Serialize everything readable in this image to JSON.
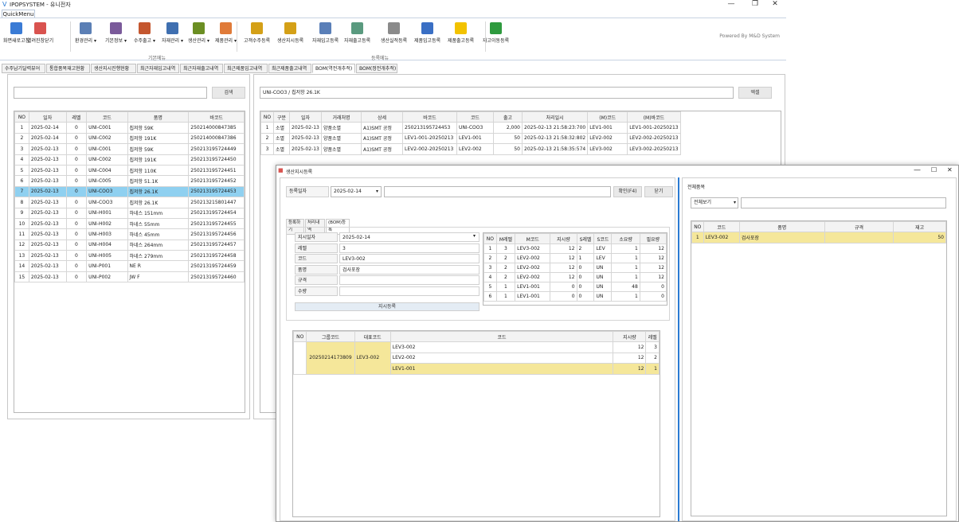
{
  "app": {
    "title": "IPOPSYSTEM - 유니전자",
    "quickmenu": "QuickMenu",
    "powered": "Powered By M&D System"
  },
  "window": {
    "min": "—",
    "restore": "❐",
    "close": "✕"
  },
  "ribbon": {
    "buttons": [
      {
        "label": "화면새로고침",
        "color": "#3a7bd5"
      },
      {
        "label": "열려진창닫기",
        "color": "#d9534f"
      },
      {
        "label": "환경관리 ▾",
        "color": "#5b7fb5"
      },
      {
        "label": "기본정보 ▾",
        "color": "#7a5a9a"
      },
      {
        "label": "수주출고 ▾",
        "color": "#c4572f"
      },
      {
        "label": "자재관리 ▾",
        "color": "#3f6fb0"
      },
      {
        "label": "생산관리 ▾",
        "color": "#6b8e23"
      },
      {
        "label": "제품관리 ▾",
        "color": "#e07b39"
      },
      {
        "label": "고객수주등록",
        "color": "#d4a017"
      },
      {
        "label": "생산지시등록",
        "color": "#d4a017"
      },
      {
        "label": "자재입고등록",
        "color": "#5a7fb8"
      },
      {
        "label": "자재출고등록",
        "color": "#5a9a7f"
      },
      {
        "label": "생산실적등록",
        "color": "#8a8a8a"
      },
      {
        "label": "제품입고등록",
        "color": "#3a6fc4"
      },
      {
        "label": "제품출고등록",
        "color": "#f2c200"
      },
      {
        "label": "재고이동등록",
        "color": "#2e9a3e"
      }
    ],
    "group_basic": "기본메뉴",
    "group_reg": "등록메뉴"
  },
  "tabs": [
    "수주납기달력뷰어",
    "통합품목재고현황",
    "생산지시진행현황",
    "최근자재입고내역",
    "최근자재출고내역",
    "최근제품입고내역",
    "최근제품출고내역",
    "BOM(역전개추적)",
    "BOM(정전개추적)"
  ],
  "left": {
    "search_value": "",
    "search_btn": "검색",
    "headers": [
      "NO",
      "일자",
      "레벨",
      "코드",
      "품명",
      "바코드"
    ],
    "rows": [
      [
        "1",
        "2025-02-14",
        "0",
        "UNI-C001",
        "칩저항 59K",
        "250214000847385"
      ],
      [
        "2",
        "2025-02-14",
        "0",
        "UNI-C002",
        "칩저항 191K",
        "250214000847386"
      ],
      [
        "3",
        "2025-02-13",
        "0",
        "UNI-C001",
        "칩저항 59K",
        "250213195724449"
      ],
      [
        "4",
        "2025-02-13",
        "0",
        "UNI-C002",
        "칩저항 191K",
        "250213195724450"
      ],
      [
        "5",
        "2025-02-13",
        "0",
        "UNI-C004",
        "칩저항 110K",
        "250213195724451"
      ],
      [
        "6",
        "2025-02-13",
        "0",
        "UNI-C005",
        "칩저항 51.1K",
        "250213195724452"
      ],
      [
        "7",
        "2025-02-13",
        "0",
        "UNI-COO3",
        "칩저항 26.1K",
        "250213195724453"
      ],
      [
        "8",
        "2025-02-13",
        "0",
        "UNI-COO3",
        "칩저항 26.1K",
        "250213215801447"
      ],
      [
        "9",
        "2025-02-13",
        "0",
        "UNI-H001",
        "하네스 151mm",
        "250213195724454"
      ],
      [
        "10",
        "2025-02-13",
        "0",
        "UNI-H002",
        "하네스 55mm",
        "250213195724455"
      ],
      [
        "11",
        "2025-02-13",
        "0",
        "UNI-H003",
        "하네스 45mm",
        "250213195724456"
      ],
      [
        "12",
        "2025-02-13",
        "0",
        "UNI-H004",
        "하네스 264mm",
        "250213195724457"
      ],
      [
        "13",
        "2025-02-13",
        "0",
        "UNI-H005",
        "하네스 279mm",
        "250213195724458"
      ],
      [
        "14",
        "2025-02-13",
        "0",
        "UNI-P001",
        "NE R",
        "250213195724459"
      ],
      [
        "15",
        "2025-02-13",
        "0",
        "UNI-P002",
        "JW F",
        "250213195724460"
      ]
    ]
  },
  "right": {
    "title_value": "UNI-COO3 / 칩저항 26.1K",
    "excel_btn": "엑셀",
    "headers": [
      "NO",
      "구분",
      "일자",
      "거래처명",
      "상세",
      "바코드",
      "코드",
      "출고",
      "처리일시",
      "(M)코드",
      "(M)바코드"
    ],
    "rows": [
      [
        "1",
        "소멸",
        "2025-02-13",
        "양품소멸",
        "A1)SMT 공정",
        "250213195724453",
        "UNI-COO3",
        "2,000",
        "2025-02-13 21:58:23:700",
        "LEV1-001",
        "LEV1-001-20250213"
      ],
      [
        "2",
        "소멸",
        "2025-02-13",
        "양품소멸",
        "A1)SMT 공정",
        "LEV1-001-20250213",
        "LEV1-001",
        "50",
        "2025-02-13 21:58:32:802",
        "LEV2-002",
        "LEV2-002-20250213"
      ],
      [
        "3",
        "소멸",
        "2025-02-13",
        "양품소멸",
        "A1)SMT 공정",
        "LEV2-002-20250213",
        "LEV2-002",
        "50",
        "2025-02-13 21:58:35:574",
        "LEV3-002",
        "LEV3-002-20250213"
      ]
    ]
  },
  "dialog": {
    "title": "생산지시등록",
    "reg_date_label": "등록일자",
    "reg_date": "2025-02-14",
    "memo": "",
    "confirm_btn": "확인(F4)",
    "close_btn": "닫기",
    "subtabs": [
      "등록하기",
      "처리내역",
      "(BOM)등록"
    ],
    "form": [
      {
        "label": "지시일자",
        "value": "2025-02-14"
      },
      {
        "label": "레벨",
        "value": "3"
      },
      {
        "label": "코드",
        "value": "LEV3-002"
      },
      {
        "label": "품명",
        "value": "검사포장"
      },
      {
        "label": "규격",
        "value": ""
      },
      {
        "label": "수량",
        "value": ""
      }
    ],
    "order_btn": "지시등록",
    "bom_headers": [
      "NO",
      "M레벨",
      "M코드",
      "지시량",
      "S레벨",
      "S코드",
      "소요량",
      "필요량"
    ],
    "bom_rows": [
      [
        "1",
        "3",
        "LEV3-002",
        "12",
        "2",
        "LEV",
        "1",
        "12"
      ],
      [
        "2",
        "2",
        "LEV2-002",
        "12",
        "1",
        "LEV",
        "1",
        "12"
      ],
      [
        "3",
        "2",
        "LEV2-002",
        "12",
        "0",
        "UN",
        "1",
        "12"
      ],
      [
        "4",
        "2",
        "LEV2-002",
        "12",
        "0",
        "UN",
        "1",
        "12"
      ],
      [
        "5",
        "1",
        "LEV1-001",
        "0",
        "0",
        "UN",
        "48",
        "0"
      ],
      [
        "6",
        "1",
        "LEV1-001",
        "0",
        "0",
        "UN",
        "1",
        "0"
      ]
    ],
    "order_headers": [
      "NO",
      "그룹코드",
      "대표코드",
      "코드",
      "지시량",
      "레벨"
    ],
    "group_code": "20250214173809",
    "rep_code": "LEV3-002",
    "order_rows": [
      [
        "LEV3-002",
        "12",
        "3"
      ],
      [
        "LEV2-002",
        "12",
        "2"
      ],
      [
        "LEV1-001",
        "12",
        "1"
      ]
    ],
    "all_title": "전체품목",
    "all_filter": "전체보기",
    "all_search": "",
    "all_headers": [
      "NO",
      "코드",
      "품명",
      "규격",
      "재고"
    ],
    "all_rows": [
      [
        "1",
        "LEV3-002",
        "검사포장",
        "",
        "50"
      ]
    ]
  }
}
